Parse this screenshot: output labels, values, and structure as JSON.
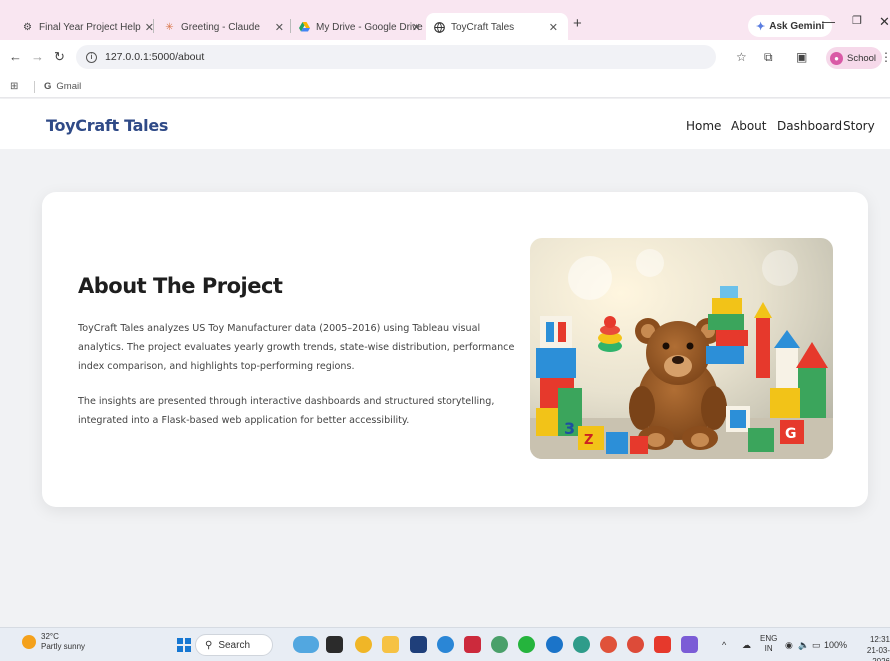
{
  "browser": {
    "tabs": [
      {
        "title": "Final Year Project Help",
        "active": false
      },
      {
        "title": "Greeting - Claude",
        "active": false
      },
      {
        "title": "My Drive - Google Drive",
        "active": false
      },
      {
        "title": "ToyCraft Tales",
        "active": true
      }
    ],
    "ask_gemini": "Ask Gemini",
    "url": "127.0.0.1:5000/about",
    "profile_label": "School",
    "bookmarks": [
      {
        "label": "Gmail"
      }
    ]
  },
  "site": {
    "brand": "ToyCraft Tales",
    "nav": [
      "Home",
      "About",
      "Dashboard",
      "Story"
    ]
  },
  "about": {
    "heading": "About The Project",
    "paragraph1": "ToyCraft Tales analyzes US Toy Manufacturer data (2005–2016) using Tableau visual analytics. The project evaluates yearly growth trends, state-wise distribution, performance index comparison, and highlights top-performing regions.",
    "paragraph2": "The insights are presented through interactive dashboards and structured storytelling, integrated into a Flask-based web application for better accessibility.",
    "image_subject": "toys-teddy-bear-blocks"
  },
  "taskbar": {
    "weather_temp": "32°C",
    "weather_desc": "Partly sunny",
    "search_label": "Search",
    "lang_line1": "ENG",
    "lang_line2": "IN",
    "battery": "100%",
    "time": "12:31",
    "date": "21-03-2026"
  },
  "colors": {
    "brand": "#2f4a87",
    "tabstrip": "#f9e6f1",
    "page_bg": "#f1f2f4"
  }
}
